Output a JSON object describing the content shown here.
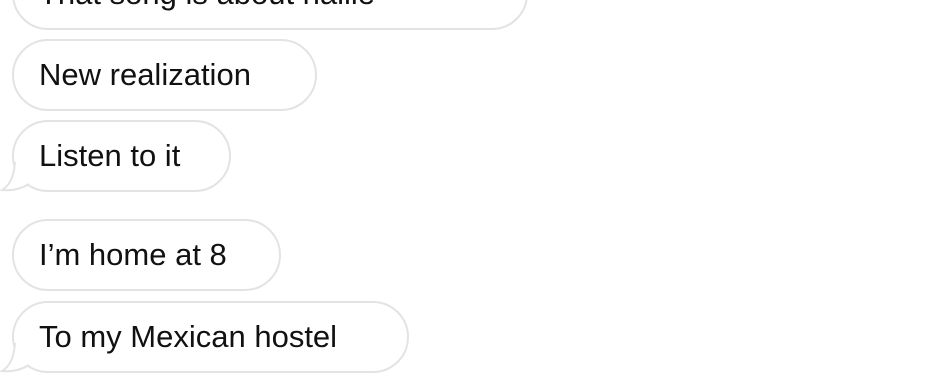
{
  "conversation": {
    "messages": [
      {
        "text": "That song is about hallie",
        "direction": "received",
        "has_tail": false
      },
      {
        "text": "New realization",
        "direction": "received",
        "has_tail": false
      },
      {
        "text": "Listen to it",
        "direction": "received",
        "has_tail": true
      },
      {
        "text": "I’m home at 8",
        "direction": "received",
        "has_tail": false
      },
      {
        "text": "To my Mexican hostel",
        "direction": "received",
        "has_tail": true
      }
    ]
  },
  "colors": {
    "background": "#ffffff",
    "bubble_fill": "#ffffff",
    "bubble_border": "#e3e3e6",
    "text": "#111111"
  }
}
